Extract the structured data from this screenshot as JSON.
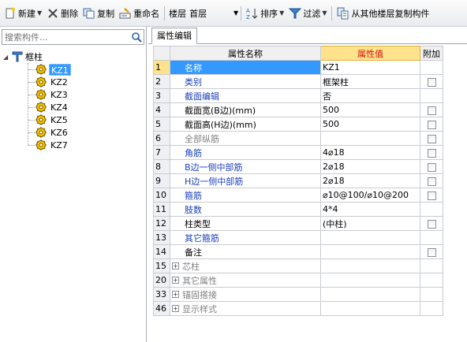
{
  "toolbar": {
    "new_label": "新建",
    "delete_label": "删除",
    "copy_label": "复制",
    "rename_label": "重命名",
    "floor_label": "楼层",
    "floor_value": "首层",
    "sort_label": "排序",
    "filter_label": "过滤",
    "copy_from_floor_label": "从其他楼层复制构件"
  },
  "sidebar": {
    "search_placeholder": "搜索构件...",
    "root_label": "框柱",
    "items": [
      "KZ1",
      "KZ2",
      "KZ3",
      "KZ4",
      "KZ5",
      "KZ6",
      "KZ7"
    ],
    "selected": "KZ1"
  },
  "panel": {
    "tab_label": "属性编辑",
    "columns": {
      "name": "属性名称",
      "value": "属性值",
      "extra": "附加"
    },
    "rows": [
      {
        "num": "1",
        "name": "名称",
        "value": "KZ1",
        "color": "blue",
        "checkbox": false,
        "selected": true
      },
      {
        "num": "2",
        "name": "类别",
        "value": "框架柱",
        "color": "blue",
        "checkbox": true
      },
      {
        "num": "3",
        "name": "截面编辑",
        "value": "否",
        "color": "blue",
        "checkbox": false
      },
      {
        "num": "4",
        "name": "截面宽(B边)(mm)",
        "value": "500",
        "color": "black",
        "checkbox": true
      },
      {
        "num": "5",
        "name": "截面高(H边)(mm)",
        "value": "500",
        "color": "black",
        "checkbox": true
      },
      {
        "num": "6",
        "name": "全部纵筋",
        "value": "",
        "color": "gray",
        "checkbox": true
      },
      {
        "num": "7",
        "name": "角筋",
        "value": "4⌀18",
        "color": "blue",
        "checkbox": true
      },
      {
        "num": "8",
        "name": "B边一侧中部筋",
        "value": "2⌀18",
        "color": "blue",
        "checkbox": true
      },
      {
        "num": "9",
        "name": "H边一侧中部筋",
        "value": "2⌀18",
        "color": "blue",
        "checkbox": true
      },
      {
        "num": "10",
        "name": "箍筋",
        "value": "⌀10@100/⌀10@200",
        "color": "blue",
        "checkbox": true
      },
      {
        "num": "11",
        "name": "肢数",
        "value": "4*4",
        "color": "blue",
        "checkbox": false
      },
      {
        "num": "12",
        "name": "柱类型",
        "value": "(中柱)",
        "color": "black",
        "checkbox": true
      },
      {
        "num": "13",
        "name": "其它箍筋",
        "value": "",
        "color": "blue",
        "checkbox": false
      },
      {
        "num": "14",
        "name": "备注",
        "value": "",
        "color": "black",
        "checkbox": true
      },
      {
        "num": "15",
        "name": "芯柱",
        "value": "",
        "color": "gray",
        "checkbox": false,
        "group": true
      },
      {
        "num": "20",
        "name": "其它属性",
        "value": "",
        "color": "gray",
        "checkbox": false,
        "group": true
      },
      {
        "num": "33",
        "name": "锚固搭接",
        "value": "",
        "color": "gray",
        "checkbox": false,
        "group": true
      },
      {
        "num": "46",
        "name": "显示样式",
        "value": "",
        "color": "gray",
        "checkbox": false,
        "group": true
      }
    ]
  },
  "icons": {
    "new": "new-file-icon",
    "delete": "x-icon",
    "copy": "copy-icon",
    "rename": "rename-icon",
    "sort": "sort-az-icon",
    "filter": "funnel-icon",
    "copy_floor": "copy-floor-icon",
    "search": "magnifier-icon",
    "tree_item": "gear-icon"
  },
  "colors": {
    "selection": "#3399ff",
    "value_header": "#ffe38c",
    "value_header_text": "#d01010",
    "blue_text": "#1a3fb8"
  }
}
